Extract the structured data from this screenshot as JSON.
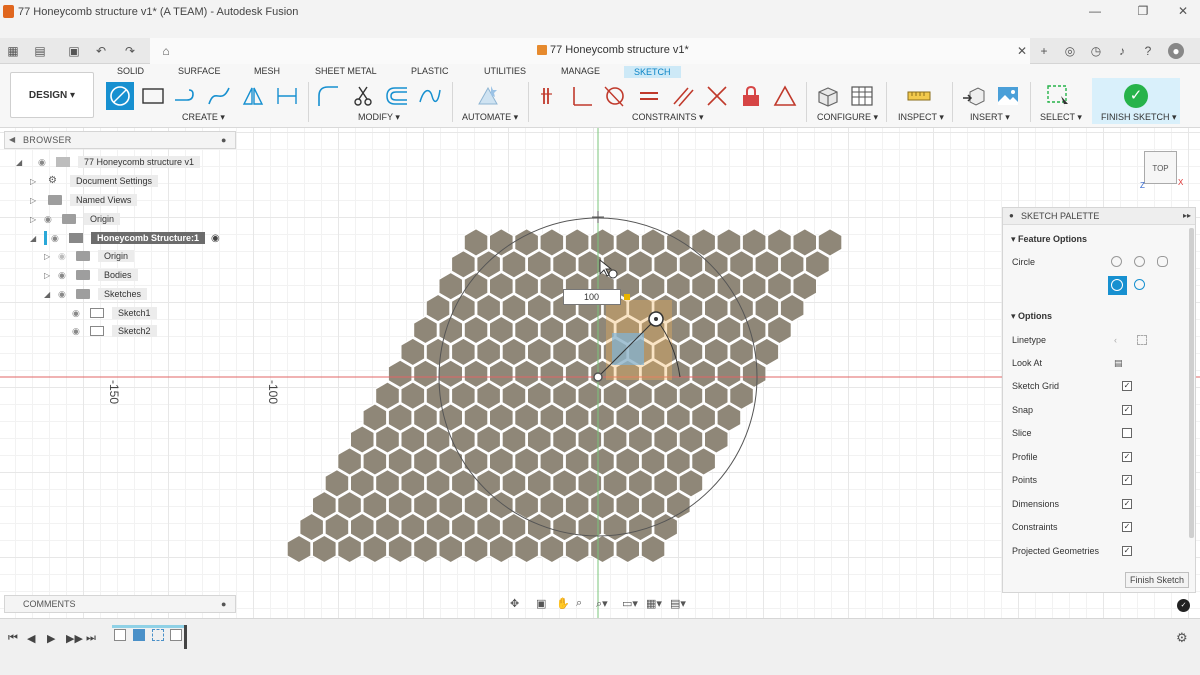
{
  "window": {
    "title": "77 Honeycomb structure v1* (A TEAM) - Autodesk Fusion"
  },
  "document_tab": {
    "title": "77 Honeycomb structure v1*"
  },
  "workspace": {
    "label": "DESIGN"
  },
  "ribbon": {
    "tabs": [
      "SOLID",
      "SURFACE",
      "MESH",
      "SHEET METAL",
      "PLASTIC",
      "UTILITIES",
      "MANAGE",
      "SKETCH"
    ],
    "active_tab": "SKETCH",
    "groups": [
      "CREATE",
      "MODIFY",
      "AUTOMATE",
      "CONSTRAINTS",
      "CONFIGURE",
      "INSPECT",
      "INSERT",
      "SELECT",
      "FINISH SKETCH"
    ]
  },
  "browser": {
    "header": "BROWSER",
    "items": [
      {
        "label": "77 Honeycomb structure v1"
      },
      {
        "label": "Document Settings"
      },
      {
        "label": "Named Views"
      },
      {
        "label": "Origin"
      },
      {
        "label": "Honeycomb Structure:1"
      },
      {
        "label": "Origin"
      },
      {
        "label": "Bodies"
      },
      {
        "label": "Sketches"
      },
      {
        "label": "Sketch1"
      },
      {
        "label": "Sketch2"
      }
    ]
  },
  "comments": {
    "header": "COMMENTS"
  },
  "canvas": {
    "axis_labels": [
      "-150",
      "-100"
    ],
    "dimension_input": "100",
    "viewcube_label": "TOP",
    "viewcube_axes": {
      "x": "X",
      "z": "Z"
    }
  },
  "palette": {
    "header": "SKETCH PALETTE",
    "feature_options_title": "Feature Options",
    "circle_label": "Circle",
    "options_title": "Options",
    "options": [
      {
        "label": "Linetype",
        "kind": "icons"
      },
      {
        "label": "Look At",
        "kind": "icon"
      },
      {
        "label": "Sketch Grid",
        "checked": true
      },
      {
        "label": "Snap",
        "checked": true
      },
      {
        "label": "Slice",
        "checked": false
      },
      {
        "label": "Profile",
        "checked": true
      },
      {
        "label": "Points",
        "checked": true
      },
      {
        "label": "Dimensions",
        "checked": true
      },
      {
        "label": "Constraints",
        "checked": true
      },
      {
        "label": "Projected Geometries",
        "checked": true
      }
    ],
    "finish_button": "Finish Sketch"
  },
  "colors": {
    "accent": "#0a84c6",
    "hex_fill": "#8f8778",
    "finish_green": "#27b34a"
  }
}
